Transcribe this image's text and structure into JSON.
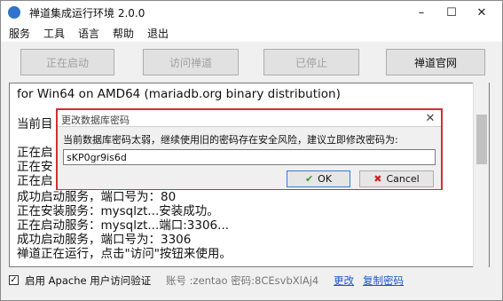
{
  "window": {
    "title": "禅道集成运行环境 2.0.0",
    "min": "–",
    "max": "☐",
    "close": "✕"
  },
  "menu": [
    "服务",
    "工具",
    "语言",
    "帮助",
    "退出"
  ],
  "toolbar": {
    "starting": "正在启动",
    "visit": "访问禅道",
    "stopped": "已停止",
    "official": "禅道官网"
  },
  "log": {
    "lines": [
      "for Win64 on AMD64 (mariadb.org binary distribution)",
      "",
      "当前目",
      "",
      "正在启",
      "正在安",
      "正在启",
      "成功启动服务，端口号为：80",
      "正在安装服务：mysqlzt...安装成功。",
      "正在启动服务：mysqlzt...端口:3306...",
      "成功启动服务，端口号为：3306",
      "禅道正在运行，点击\"访问\"按钮来使用。"
    ]
  },
  "status": {
    "checkbox_mark": "✓",
    "checkbox_label": "启用 Apache 用户访问验证",
    "account": "账号 :zentao 密码:8CEsvbXlAj4",
    "change": "更改",
    "copy_password": "复制密码"
  },
  "dialog": {
    "title": "更改数据库密码",
    "close": "✕",
    "message": "当前数据库密码太弱，继续使用旧的密码存在安全风险，建议立即修改密码为:",
    "password": "sKP0gr9is6d",
    "ok": "OK",
    "cancel": "Cancel"
  }
}
